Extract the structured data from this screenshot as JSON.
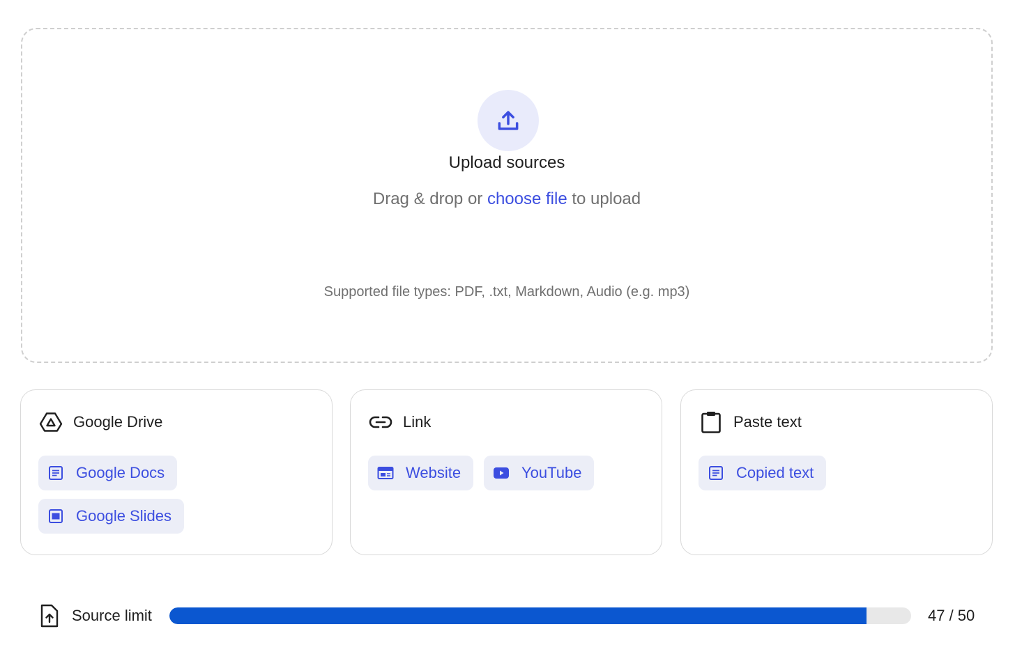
{
  "upload": {
    "title": "Upload sources",
    "subtitle_prefix": "Drag & drop or ",
    "choose_file_link": "choose file",
    "subtitle_suffix": " to upload",
    "supported_types": "Supported file types: PDF, .txt, Markdown, Audio (e.g. mp3)",
    "icon": "upload-icon"
  },
  "cards": {
    "drive": {
      "title": "Google Drive",
      "icon": "google-drive-icon",
      "chips": [
        {
          "label": "Google Docs",
          "icon": "docs-icon"
        },
        {
          "label": "Google Slides",
          "icon": "slides-icon"
        }
      ]
    },
    "link": {
      "title": "Link",
      "icon": "link-icon",
      "chips": [
        {
          "label": "Website",
          "icon": "website-icon"
        },
        {
          "label": "YouTube",
          "icon": "youtube-icon"
        }
      ]
    },
    "paste": {
      "title": "Paste text",
      "icon": "clipboard-icon",
      "chips": [
        {
          "label": "Copied text",
          "icon": "text-doc-icon"
        }
      ]
    }
  },
  "source_limit": {
    "label": "Source limit",
    "used": 47,
    "max": 50,
    "count_text": "47 / 50",
    "fill_fraction": 0.94
  },
  "colors": {
    "accent": "#3c4ee0",
    "progress": "#0b57d0",
    "chip_bg": "#eceef7",
    "upload_circle_bg": "#e9ebfb"
  }
}
